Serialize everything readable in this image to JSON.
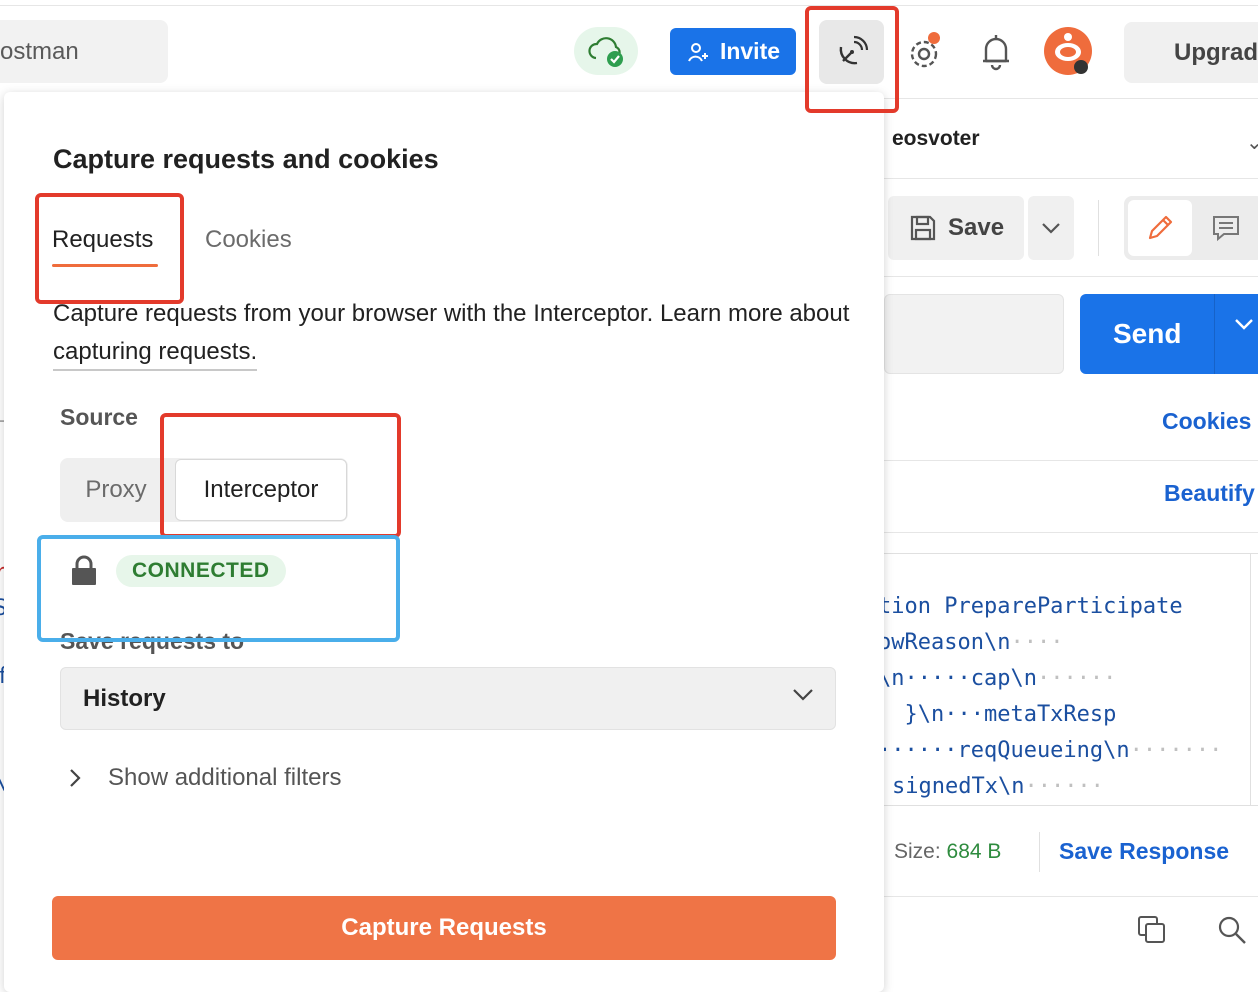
{
  "topbar": {
    "search_text": "ostman",
    "invite_label": "Invite",
    "upgrade_label": "Upgrad",
    "icons": [
      "cloud-sync-icon",
      "capture-icon",
      "settings-icon",
      "bell-icon",
      "avatar"
    ]
  },
  "popover": {
    "title": "Capture requests and cookies",
    "tabs": {
      "requests": "Requests",
      "cookies": "Cookies"
    },
    "description_text": "Capture requests from your browser with the Interceptor. Learn more about ",
    "description_link": "capturing requests.",
    "source_label": "Source",
    "source_options": {
      "proxy": "Proxy",
      "interceptor": "Interceptor"
    },
    "status_badge": "CONNECTED",
    "save_to_label": "Save requests to",
    "save_to_value": "History",
    "filters_label": "Show additional filters",
    "capture_button": "Capture Requests"
  },
  "background": {
    "request_name": "eosvoter",
    "save_label": "Save",
    "send_label": "Send",
    "cookies_link": "Cookies",
    "beautify_link": "Beautify",
    "code_lines": [
      {
        "text": "tion PrepareParticipate",
        "dots": ""
      },
      {
        "text": "owReason\\n",
        "dots": "····"
      },
      {
        "text": "\\n·····cap\\n",
        "dots": "······"
      },
      {
        "text": "  }\\n···metaTxResp",
        "dots": ""
      },
      {
        "text": "······reqQueueing\\n",
        "dots": "·······"
      },
      {
        "text": "signedTx\\n",
        "dots": "······"
      }
    ],
    "size_label": "Size:",
    "size_value": "684 B",
    "save_response_label": "Save Response"
  },
  "colors": {
    "accent_orange": "#ef7446",
    "primary_blue": "#1a73e8",
    "connected_green": "#2e7d32",
    "annotation_red": "#e33a2b",
    "annotation_blue": "#4aaeea"
  }
}
